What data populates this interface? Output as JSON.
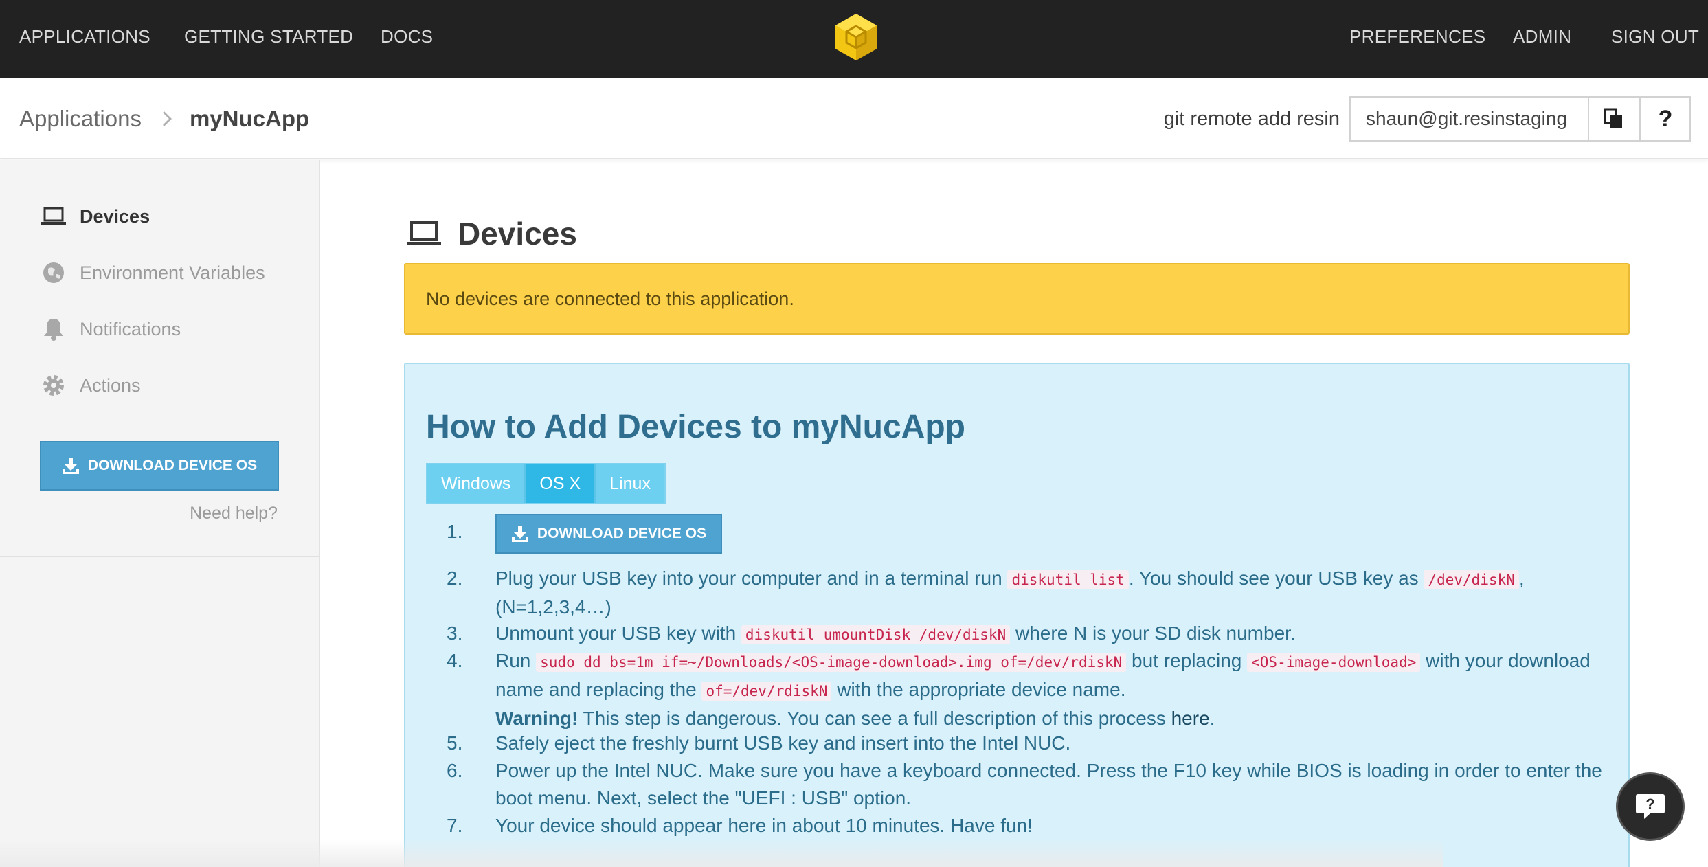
{
  "topnav": {
    "links_left": [
      "APPLICATIONS",
      "GETTING STARTED",
      "DOCS"
    ],
    "links_right": [
      "PREFERENCES",
      "ADMIN",
      "SIGN OUT"
    ],
    "logo_color": "#f3c613"
  },
  "header": {
    "breadcrumb_root": "Applications",
    "breadcrumb_current": "myNucApp",
    "git_label": "git remote add resin",
    "git_value": "shaun@git.resinstaging",
    "help_label": "?"
  },
  "sidebar": {
    "items": [
      {
        "label": "Devices",
        "icon": "laptop-icon"
      },
      {
        "label": "Environment Variables",
        "icon": "globe-icon"
      },
      {
        "label": "Notifications",
        "icon": "bell-icon"
      },
      {
        "label": "Actions",
        "icon": "gear-icon"
      }
    ],
    "download_label": "DOWNLOAD DEVICE OS",
    "need_help": "Need help?"
  },
  "main": {
    "title": "Devices",
    "alert": "No devices are connected to this application.",
    "howto_title": "How to Add Devices to myNucApp",
    "tabs": [
      "Windows",
      "OS X",
      "Linux"
    ],
    "active_tab": "OS X",
    "steps": {
      "s1_button": "DOWNLOAD DEVICE OS",
      "s2_a": "Plug your USB key into your computer and in a terminal run ",
      "s2_code1": "diskutil list",
      "s2_b": ". You should see your USB key as ",
      "s2_code2": "/dev/diskN",
      "s2_c": ", (N=1,2,3,4…)",
      "s3_a": "Unmount your USB key with ",
      "s3_code": "diskutil umountDisk /dev/diskN",
      "s3_b": " where N is your SD disk number.",
      "s4_a": "Run ",
      "s4_code1": "sudo dd bs=1m if=~/Downloads/<OS-image-download>.img of=/dev/rdiskN",
      "s4_b": " but replacing ",
      "s4_code2": "<OS-image-download>",
      "s4_c": " with your download name and replacing the ",
      "s4_code3": "of=/dev/rdiskN",
      "s4_d": " with the appropriate device name.",
      "s4_warn": "Warning!",
      "s4_e": " This step is dangerous. You can see a full description of this process ",
      "s4_link": "here",
      "s4_f": ".",
      "s5": "Safely eject the freshly burnt USB key and insert into the Intel NUC.",
      "s6": "Power up the Intel NUC. Make sure you have a keyboard connected. Press the F10 key while BIOS is loading in order to enter the boot menu. Next, select the \"UEFI : USB\" option.",
      "s7": "Your device should appear here in about 10 minutes. Have fun!"
    },
    "numbers": [
      "1.",
      "2.",
      "3.",
      "4.",
      "5.",
      "6.",
      "7."
    ]
  }
}
